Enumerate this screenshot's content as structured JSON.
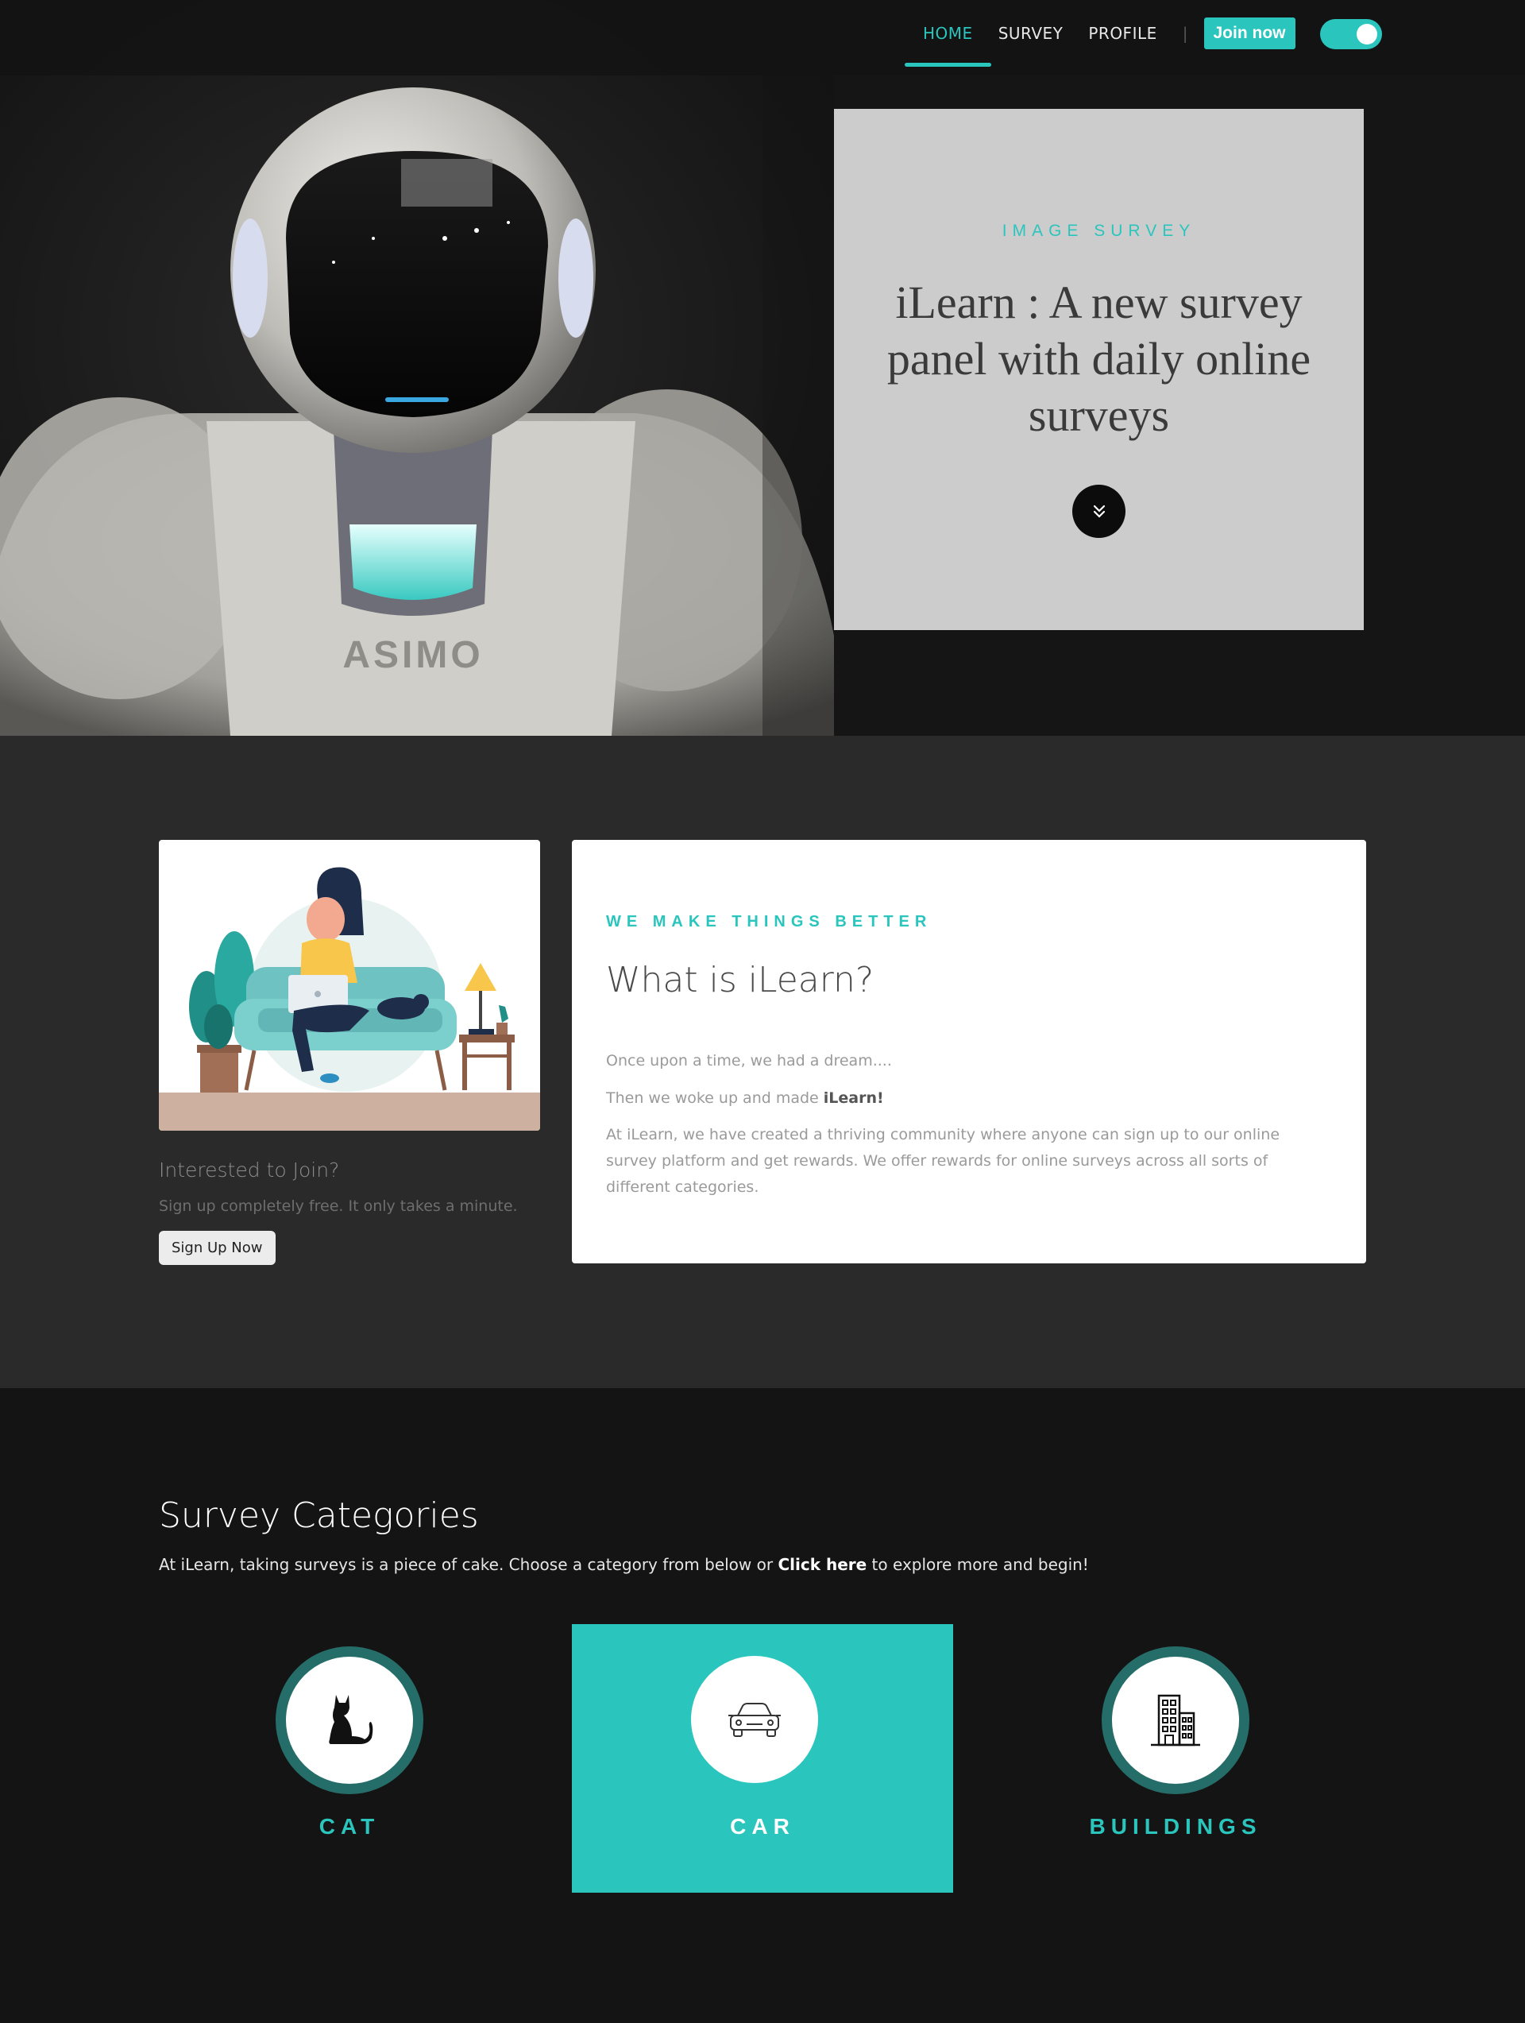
{
  "nav": {
    "links": [
      "HOME",
      "SURVEY",
      "PROFILE"
    ],
    "separator": "|",
    "join_label": "Join now",
    "toggle_on": true
  },
  "hero": {
    "eyebrow": "IMAGE SURVEY",
    "title": "iLearn : A new survey panel with daily online surveys",
    "scroll_icon": "double-chevron-down-icon"
  },
  "about": {
    "join_title": "Interested to Join?",
    "join_sub": "Sign up completely free. It only takes a minute.",
    "signup_label": "Sign Up Now",
    "eyebrow": "WE MAKE THINGS BETTER",
    "title": "What is iLearn?",
    "p1": "Once upon a time, we had a dream....",
    "p2_prefix": "Then we woke up and made ",
    "p2_bold": "iLearn!",
    "p3": "At iLearn, we have created a thriving community where anyone can sign up to our online survey platform and get rewards. We offer rewards for online surveys across all sorts of different categories."
  },
  "categories": {
    "title": "Survey Categories",
    "sub_prefix": "At iLearn, taking surveys is a piece of cake. Choose a category from below or ",
    "sub_link": "Click here",
    "sub_suffix": " to explore more and begin!",
    "items": [
      {
        "label": "CAT",
        "icon": "cat-icon",
        "active": false
      },
      {
        "label": "CAR",
        "icon": "car-icon",
        "active": true
      },
      {
        "label": "BUILDINGS",
        "icon": "building-icon",
        "active": false
      }
    ]
  },
  "colors": {
    "accent": "#2ac5bd",
    "ring": "#256d68",
    "hero_card": "#cccccc",
    "about_bg": "#2a2a2a",
    "page_bg": "#141414"
  }
}
